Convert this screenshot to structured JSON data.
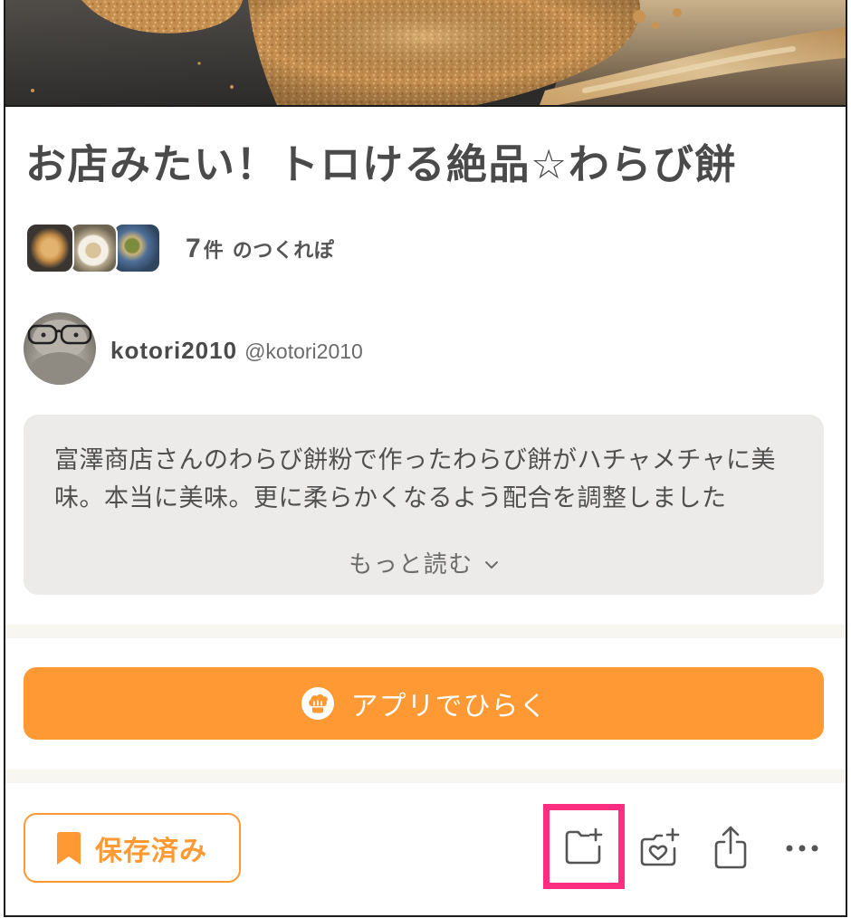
{
  "recipe": {
    "title": "お店みたい！トロける絶品☆わらび餅"
  },
  "cooksnaps": {
    "count": "7",
    "unit": "件",
    "label": "のつくれぽ"
  },
  "author": {
    "name": "kotori2010",
    "handle": "@kotori2010"
  },
  "description": {
    "text": "富澤商店さんのわらび餅粉で作ったわらび餅がハチャメチャに美味。本当に美味。更に柔らかくなるよう配合を調整しました",
    "read_more": "もっと読む",
    "read_more_icon": "chevron-down-icon"
  },
  "open_app": {
    "label": "アプリでひらく",
    "icon": "chef-hat-icon"
  },
  "actions": {
    "saved": {
      "label": "保存済み",
      "icon": "bookmark-icon"
    },
    "add_to_folder": {
      "icon": "folder-add-icon",
      "highlighted": true
    },
    "cooksnap": {
      "icon": "camera-heart-icon"
    },
    "share": {
      "icon": "share-icon"
    },
    "more": {
      "icon": "more-icon"
    }
  },
  "colors": {
    "accent": "#ff9933",
    "text": "#4a4a4a",
    "muted": "#6b6b6b",
    "description_bg": "#ecebe9",
    "divider": "#f8f6f1",
    "highlight": "#ff2d80"
  }
}
